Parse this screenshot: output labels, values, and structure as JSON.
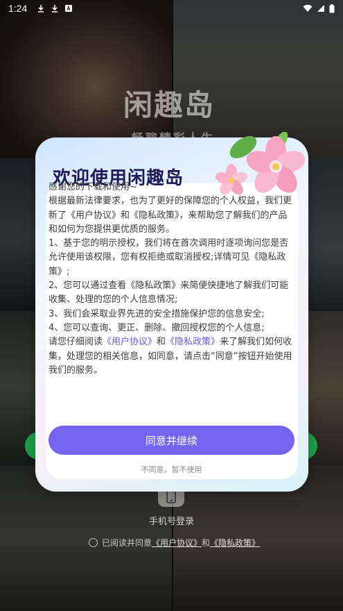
{
  "status_bar": {
    "time": "1:24"
  },
  "background": {
    "app_logo_text": "闲趣岛",
    "slogan": "畅聊精彩人生"
  },
  "login": {
    "phone_login_label": "手机号登录",
    "agree_prefix": "已阅读并同意",
    "agree_user_agreement": "《用户协议》",
    "agree_and": "和",
    "agree_privacy_policy": "《隐私政策》"
  },
  "dialog": {
    "title": "欢迎使用闲趣岛",
    "paragraphs": {
      "p1": "感谢您的下载和使用~",
      "p2": "根据最新法律要求，也为了更好的保障您的个人权益，我们更新了《用户协议》和《隐私政策》，来帮助您了解我们的产品和如何为您提供更优质的服务。",
      "p3": "1、基于您的明示授权，我们将在首次调用时逐项询问您是否允许使用该权限，您有权拒绝或取消授权;详情可见《隐私政策》;",
      "p4": "2、您可以通过查看《隐私政策》来简便快捷地了解我们可能收集、处理的您的个人信息情况;",
      "p5": "3、我们会采取业界先进的安全措施保护您的信息安全;",
      "p6": "4、您可以查询、更正、删除、撤回授权您的个人信息;",
      "p7_before": "请您仔细阅读",
      "p7_link1": "《用户协议》",
      "p7_and": "和",
      "p7_link2": "《隐私政策》",
      "p7_after": "来了解我们如何收集，处理您的相关信息，如同意，请点击“同意”按钮开始使用我们的服务。"
    },
    "agree_button": "同意并继续",
    "decline_link": "不同意，暂不使用"
  },
  "colors": {
    "primary": "#7663f0",
    "link": "#6a5be7",
    "title": "#1f1a55"
  }
}
